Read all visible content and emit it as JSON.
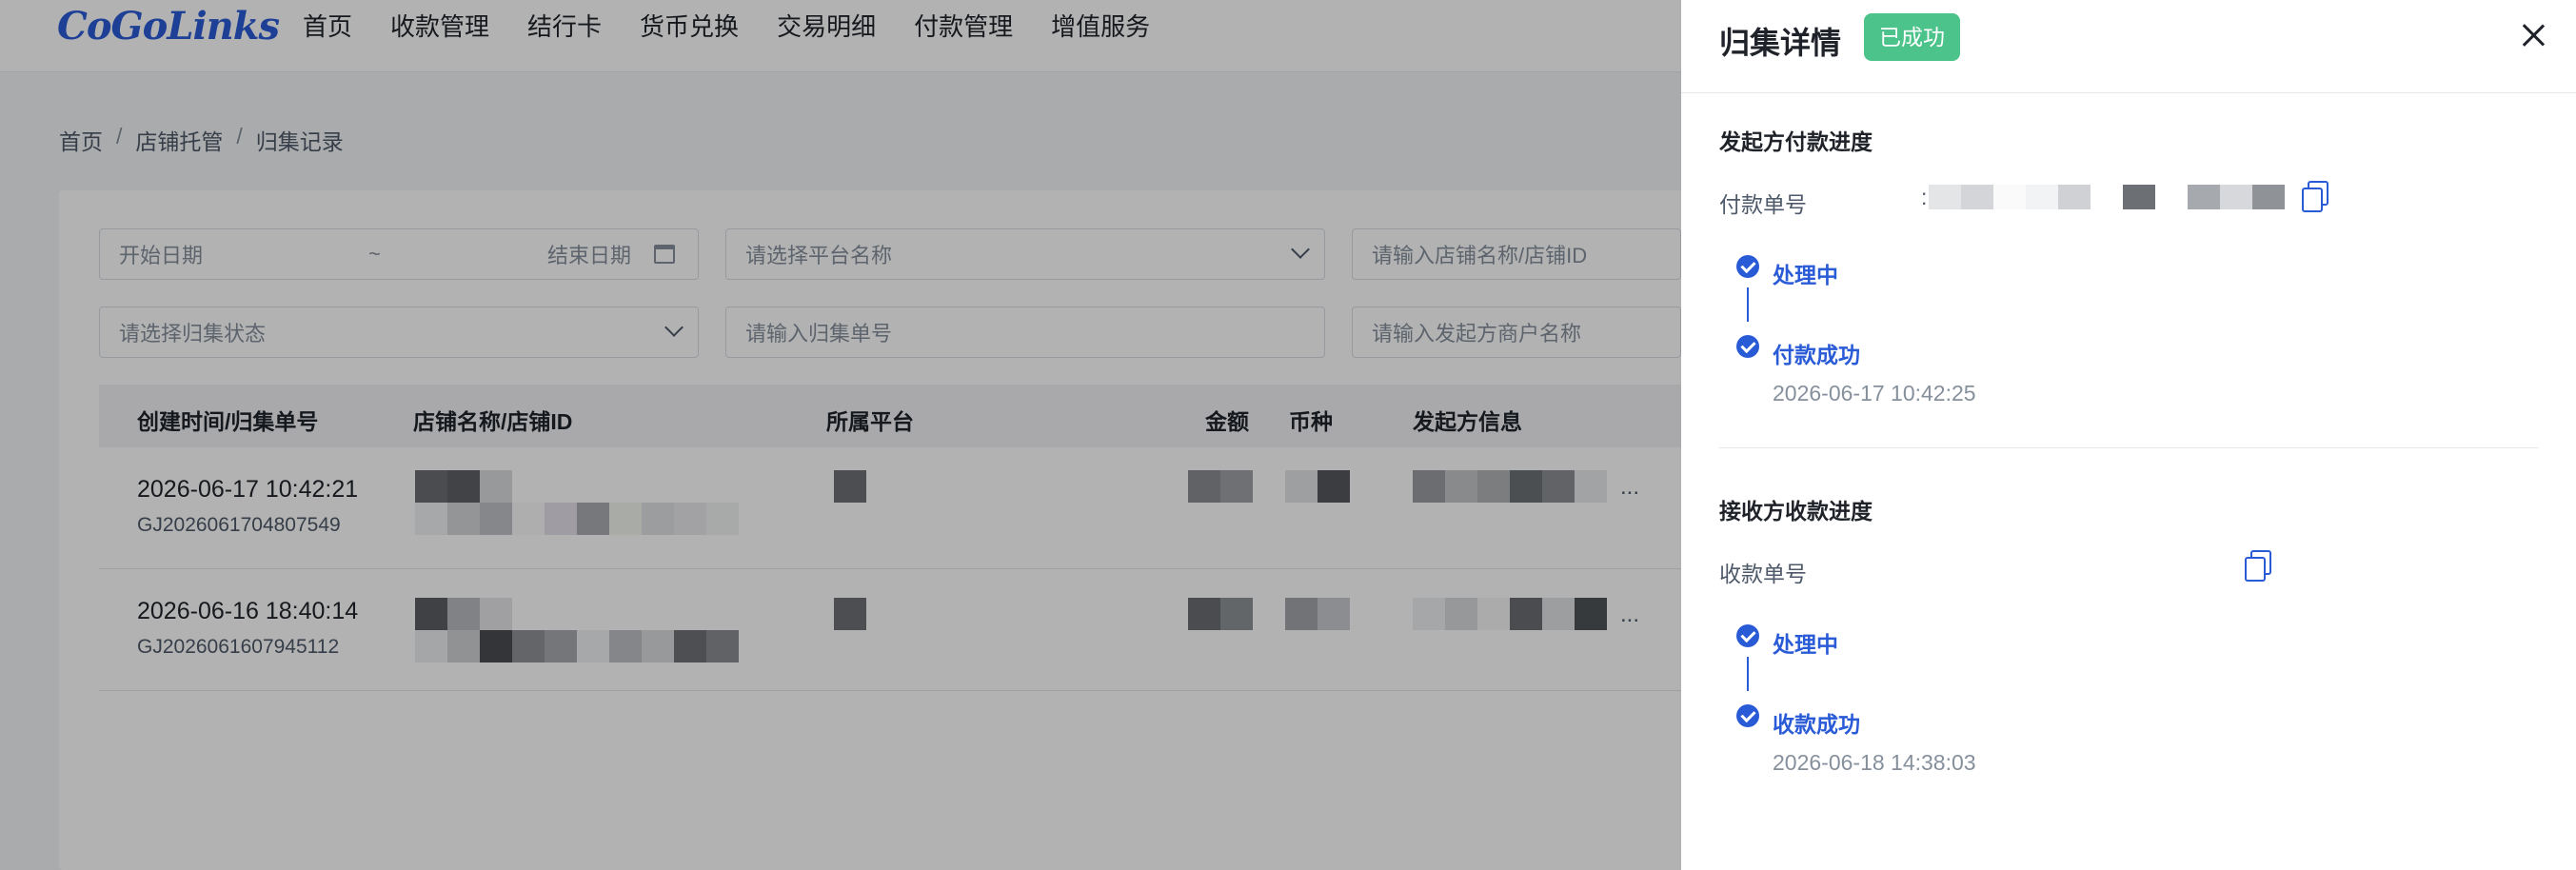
{
  "app": {
    "logo": "CoGoLinks",
    "nav": [
      "首页",
      "收款管理",
      "结行卡",
      "货币兑换",
      "交易明细",
      "付款管理",
      "增值服务"
    ]
  },
  "breadcrumb": [
    "首页",
    "店铺托管",
    "归集记录"
  ],
  "filters": {
    "start_date": "开始日期",
    "range_sep": "~",
    "end_date": "结束日期",
    "platform": "请选择平台名称",
    "store": "请输入店铺名称/店铺ID",
    "status": "请选择归集状态",
    "collect_no": "请输入归集单号",
    "merchant": "请输入发起方商户名称"
  },
  "table": {
    "headers": [
      "创建时间/归集单号",
      "店铺名称/店铺ID",
      "所属平台",
      "金额",
      "币种",
      "发起方信息"
    ],
    "rows": [
      {
        "time": "2026-06-17 10:42:21",
        "no": "GJ2026061704807549",
        "more": "..."
      },
      {
        "time": "2026-06-16 18:40:14",
        "no": "GJ2026061607945112",
        "more": "..."
      }
    ]
  },
  "drawer": {
    "title": "归集详情",
    "status_badge": "已成功",
    "payer": {
      "section_title": "发起方付款进度",
      "field_label": "付款单号",
      "field_prefix": ":",
      "steps": [
        {
          "label": "处理中",
          "time": ""
        },
        {
          "label": "付款成功",
          "time": "2026-06-17 10:42:25"
        }
      ]
    },
    "receiver": {
      "section_title": "接收方收款进度",
      "field_label": "收款单号",
      "steps": [
        {
          "label": "处理中",
          "time": ""
        },
        {
          "label": "收款成功",
          "time": "2026-06-18 14:38:03"
        }
      ]
    }
  },
  "colors": {
    "accent": "#2a5bd7",
    "success": "#4cc38a"
  }
}
